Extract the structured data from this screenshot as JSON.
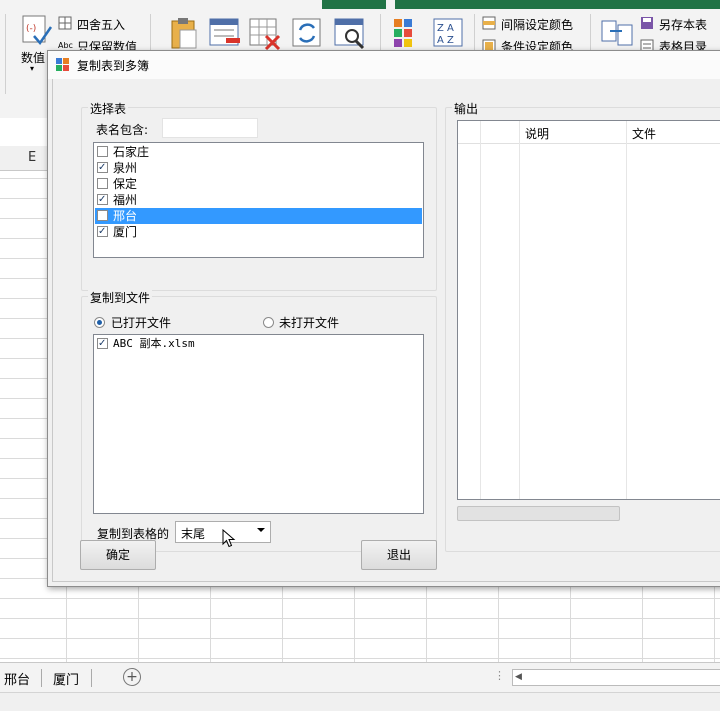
{
  "ribbon": {
    "number_label": "数值",
    "round_label": "四舍五入",
    "keep_values_label": "只保留数值",
    "interval_color_label": "间隔设定颜色",
    "conditional_color_label": "条件设定颜色",
    "save_copy_label": "另存本表",
    "table_index_label": "表格目录"
  },
  "sheet_tabs": [
    "邢台",
    "厦门"
  ],
  "column_header": "E",
  "dialog": {
    "title": "复制表到多簿",
    "select_group": {
      "title": "选择表",
      "filter_label": "表名包含:",
      "filter_value": "",
      "sheets": [
        {
          "name": "石家庄",
          "checked": false,
          "selected": false
        },
        {
          "name": "泉州",
          "checked": true,
          "selected": false
        },
        {
          "name": "保定",
          "checked": false,
          "selected": false
        },
        {
          "name": "福州",
          "checked": true,
          "selected": false
        },
        {
          "name": "邢台",
          "checked": false,
          "selected": true
        },
        {
          "name": "厦门",
          "checked": true,
          "selected": false
        }
      ]
    },
    "copy_group": {
      "title": "复制到文件",
      "radio_open": "已打开文件",
      "radio_unopened": "未打开文件",
      "radio_selected": "open",
      "files": [
        {
          "name": "ABC 副本.xlsm",
          "checked": true
        }
      ],
      "position_label": "复制到表格的",
      "position_value": "末尾"
    },
    "output_group": {
      "title": "输出",
      "columns": [
        "",
        "说明",
        "文件"
      ],
      "rows": []
    },
    "ok_button": "确定",
    "exit_button": "退出"
  }
}
